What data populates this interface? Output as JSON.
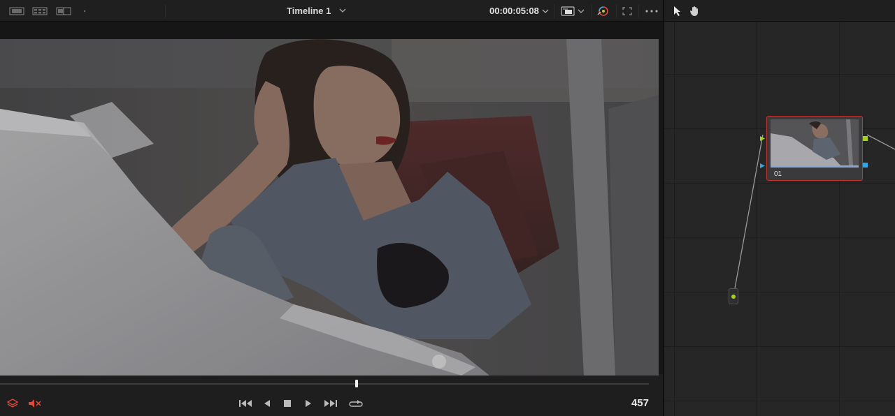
{
  "viewer": {
    "timeline_name": "Timeline 1",
    "timecode": "00:00:05:08",
    "frame_number": "457",
    "playhead_fraction": 0.55,
    "toolbar_icons": [
      "single-viewer-icon",
      "gallery-grid-icon",
      "split-wipe-icon",
      "dropdown-chevron-icon",
      "quality-hq-icon",
      "color-picker-icon",
      "fullscreen-icon",
      "more-options-icon"
    ],
    "transport_icons": [
      "layers-icon",
      "mute-icon",
      "skip-to-start-icon",
      "play-reverse-icon",
      "stop-icon",
      "play-icon",
      "skip-to-end-icon",
      "loop-icon"
    ]
  },
  "node_editor": {
    "tools": [
      "pointer-icon",
      "hand-pan-icon"
    ],
    "nodes": [
      {
        "label": "01"
      }
    ]
  },
  "colors": {
    "accent_red": "#c0352b",
    "audio_red": "#e24a3a",
    "port_green": "#a8d020",
    "port_blue": "#2aa8e8"
  }
}
